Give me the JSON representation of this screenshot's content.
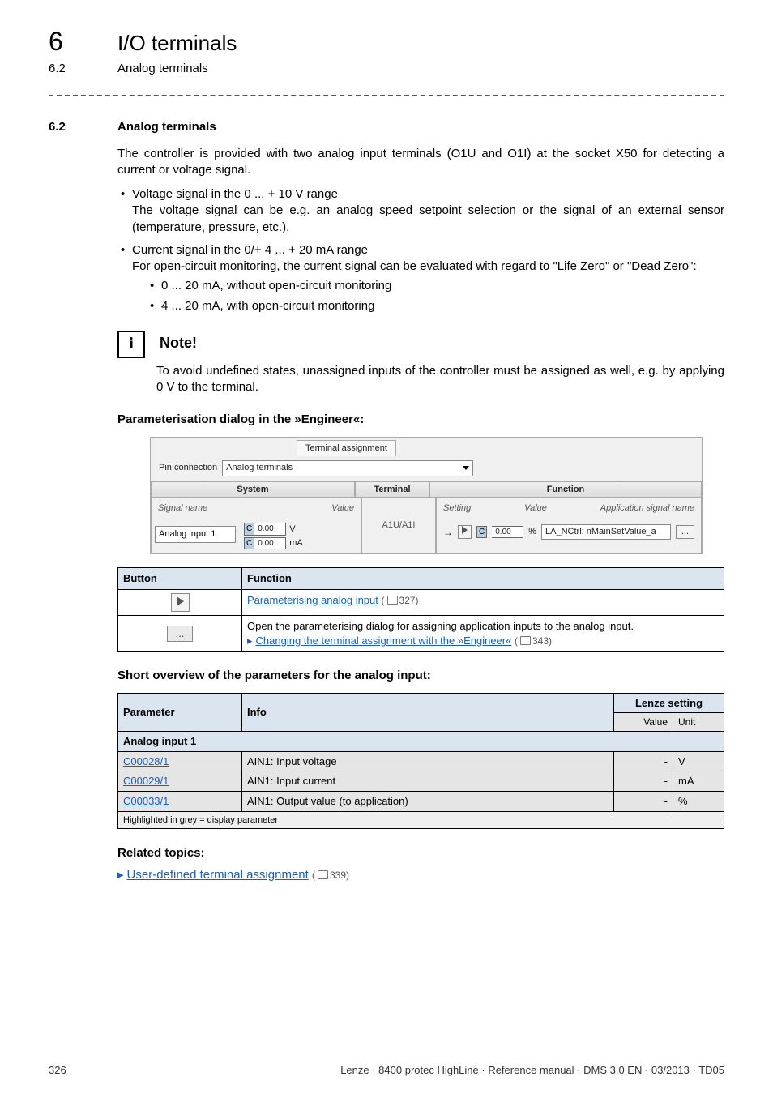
{
  "header": {
    "num": "6",
    "title": "I/O terminals"
  },
  "subheader": {
    "num": "6.2",
    "title": "Analog terminals"
  },
  "section": {
    "num": "6.2",
    "title": "Analog terminals",
    "intro": "The controller is provided with two analog input terminals (O1U and O1I) at the socket X50 for detecting a current or voltage signal.",
    "b1_line1": "Voltage signal in the 0 ... + 10 V range",
    "b1_line2": "The voltage signal can be e.g. an analog speed setpoint selection or the signal of an external sensor (temperature, pressure, etc.).",
    "b2_line1": "Current signal in the 0/+ 4 ... + 20 mA range",
    "b2_line2": "For open-circuit monitoring, the current signal can be evaluated with regard to \"Life Zero\" or \"Dead Zero\":",
    "b2_sub1": "0 ... 20 mA, without open-circuit monitoring",
    "b2_sub2": "4 ... 20 mA, with open-circuit monitoring"
  },
  "note": {
    "title": "Note!",
    "body": "To avoid undefined states, unassigned inputs of the controller must be assigned as well, e.g. by applying 0 V to the terminal."
  },
  "dialog_heading": "Parameterisation dialog in the »Engineer«:",
  "dialog": {
    "tab": "Terminal assignment",
    "pin_label": "Pin connection",
    "pin_value": "Analog terminals",
    "h_system": "System",
    "h_terminal": "Terminal",
    "h_function": "Function",
    "syshdr_signal": "Signal name",
    "syshdr_value": "Value",
    "signal_name": "Analog input 1",
    "val_v": "0.00",
    "unit_v": "V",
    "val_ma": "0.00",
    "unit_ma": "mA",
    "terminal": "A1U/A1I",
    "funchdr_setting": "Setting",
    "funchdr_value": "Value",
    "funchdr_app": "Application signal name",
    "func_val": "0.00",
    "func_unit": "%",
    "func_app": "LA_NCtrl: nMainSetValue_a",
    "dots": "..."
  },
  "func_table": {
    "h_button": "Button",
    "h_function": "Function",
    "row1_link": "Parameterising analog input",
    "row1_ref": "327",
    "row2_text": "Open the parameterising dialog for assigning application inputs to the analog input.",
    "row2_link": "Changing the terminal assignment with the »Engineer«",
    "row2_ref": "343",
    "row2_btn": "..."
  },
  "overview_heading": "Short overview of the parameters for the analog input:",
  "param_table": {
    "h_param": "Parameter",
    "h_info": "Info",
    "h_lenze": "Lenze setting",
    "sub_value": "Value",
    "sub_unit": "Unit",
    "group": "Analog input 1",
    "r1_code": "C00028/1",
    "r1_info": "AIN1: Input voltage",
    "r1_val": "-",
    "r1_unit": "V",
    "r2_code": "C00029/1",
    "r2_info": "AIN1: Input current",
    "r2_val": "-",
    "r2_unit": "mA",
    "r3_code": "C00033/1",
    "r3_info": "AIN1: Output value (to application)",
    "r3_val": "-",
    "r3_unit": "%",
    "footnote": "Highlighted in grey = display parameter"
  },
  "related": {
    "heading": "Related topics:",
    "link": "User-defined terminal assignment",
    "ref": "339"
  },
  "footer": {
    "page": "326",
    "info": "Lenze · 8400 protec HighLine · Reference manual · DMS 3.0 EN · 03/2013 · TD05"
  }
}
